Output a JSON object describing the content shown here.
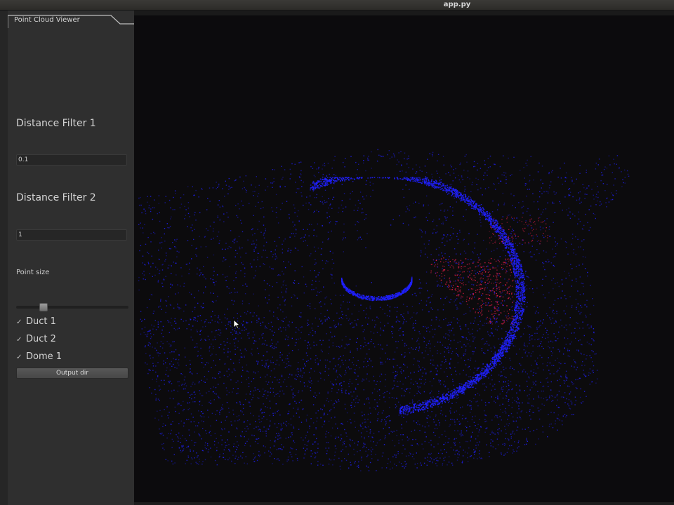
{
  "window": {
    "title": "app.py"
  },
  "panel": {
    "tab_label": "Point Cloud Viewer",
    "distance_filter_1": {
      "label": "Distance Filter 1",
      "value": "0.1"
    },
    "distance_filter_2": {
      "label": "Distance Filter 2",
      "value": "1"
    },
    "point_size": {
      "label": "Point size",
      "value_fraction": 0.22
    },
    "checkboxes": [
      {
        "label": "Duct 1",
        "checked": true
      },
      {
        "label": "Duct 2",
        "checked": true
      },
      {
        "label": "Dome 1",
        "checked": true
      }
    ],
    "output_button_label": "Output dir"
  },
  "viewer": {
    "background_color": "#0c0b0d",
    "point_color_primary": "#2020ff",
    "point_color_highlight": "#ff2050"
  },
  "icons": {
    "checkmark": "check-icon",
    "cursor": "mouse-pointer-icon"
  }
}
